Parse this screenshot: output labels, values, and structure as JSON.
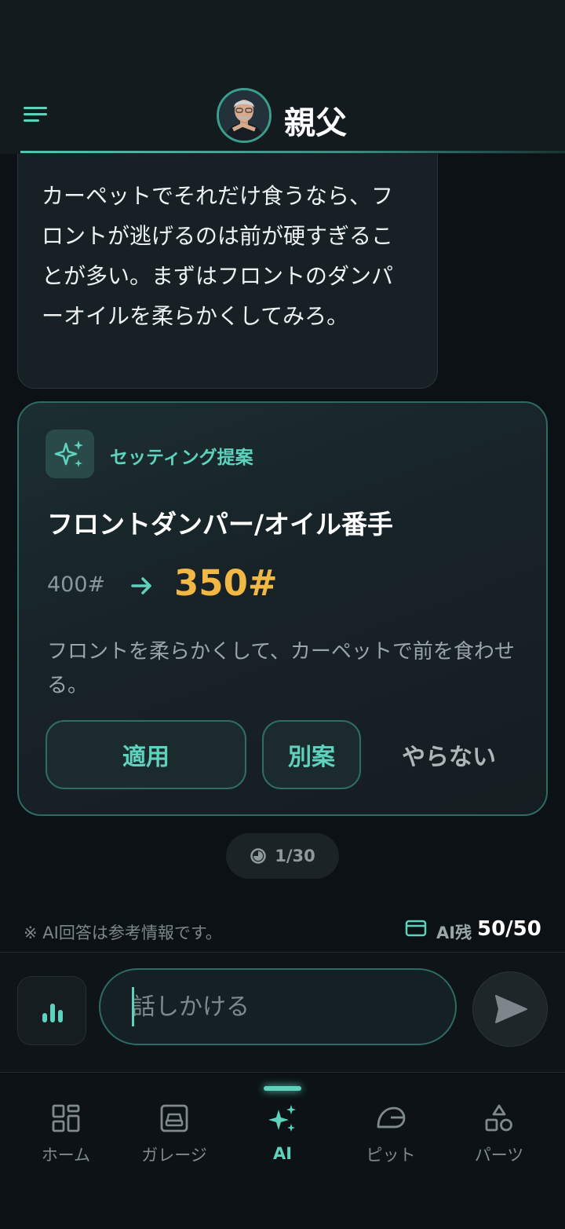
{
  "header": {
    "title": "親父",
    "menu_icon": "hamburger-menu-icon",
    "avatar": "father-avatar"
  },
  "chat": {
    "message": "カーペットでそれだけ食うなら、フロントが逃げるのは前が硬すぎることが多い。まずはフロントのダンパーオイルを柔らかくしてみろ。"
  },
  "suggestion": {
    "label": "セッティング提案",
    "title": "フロントダンパー/オイル番手",
    "old_value": "400#",
    "new_value": "350#",
    "description": "フロントを柔らかくして、カーペットで前を食わせる。",
    "apply_label": "適用",
    "alternative_label": "別案",
    "skip_label": "やらない"
  },
  "counter": {
    "text": "1/30",
    "icon": "usage-pie-icon"
  },
  "footer_info": {
    "disclaimer": "※ AI回答は参考情報です。",
    "credit_label": "AI残",
    "credit_value": "50/50"
  },
  "input": {
    "placeholder": "話しかける",
    "value": ""
  },
  "nav": {
    "items": [
      {
        "label": "ホーム",
        "icon": "home-grid-icon"
      },
      {
        "label": "ガレージ",
        "icon": "car-icon"
      },
      {
        "label": "AI",
        "icon": "sparkle-icon",
        "active": true
      },
      {
        "label": "ピット",
        "icon": "helmet-icon"
      },
      {
        "label": "パーツ",
        "icon": "shapes-icon"
      }
    ]
  },
  "colors": {
    "accent": "#5fd2bd",
    "highlight": "#f2b845",
    "background": "#0b1114"
  }
}
